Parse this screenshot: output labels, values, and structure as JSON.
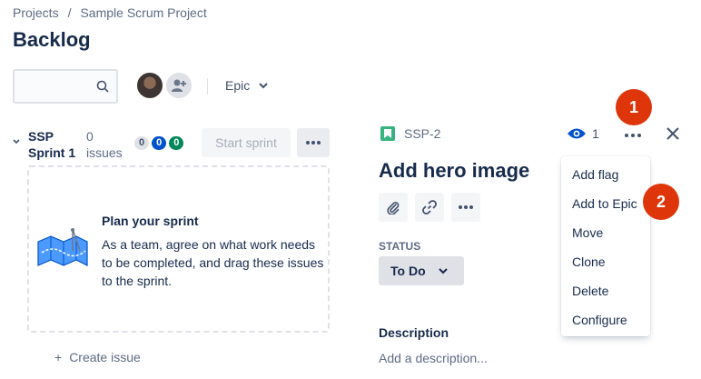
{
  "breadcrumb": {
    "root": "Projects",
    "separator": "/",
    "project": "Sample Scrum Project"
  },
  "page": {
    "title": "Backlog"
  },
  "search": {
    "placeholder": ""
  },
  "filters": {
    "epic_label": "Epic"
  },
  "sprint": {
    "name": "SSP Sprint 1",
    "issue_count": "0 issues",
    "badges": {
      "todo": "0",
      "in_progress": "0",
      "done": "0"
    },
    "start_label": "Start sprint",
    "plan_title": "Plan your sprint",
    "plan_text": "As a team, agree on what work needs to be completed, and drag these issues to the sprint.",
    "create_issue_icon": "+",
    "create_issue_label": "Create issue"
  },
  "issue": {
    "key": "SSP-2",
    "watch_count": "1",
    "title": "Add hero image",
    "status_label": "STATUS",
    "status_value": "To Do",
    "description_label": "Description",
    "description_placeholder": "Add a description..."
  },
  "menu": {
    "items": [
      "Add flag",
      "Add to Epic",
      "Move",
      "Clone",
      "Delete",
      "Configure"
    ]
  },
  "markers": [
    "1",
    "2"
  ],
  "colors": {
    "brand_blue": "#0052cc",
    "done_green": "#00875a",
    "story_green": "#36b37e",
    "marker_red": "#de350b",
    "text_primary": "#172b4d",
    "text_secondary": "#5e6c84"
  },
  "icons": [
    "search-icon",
    "add-user-icon",
    "chevron-down-icon",
    "more-icon",
    "story-icon",
    "eye-icon",
    "close-icon",
    "attachment-icon",
    "link-icon"
  ]
}
